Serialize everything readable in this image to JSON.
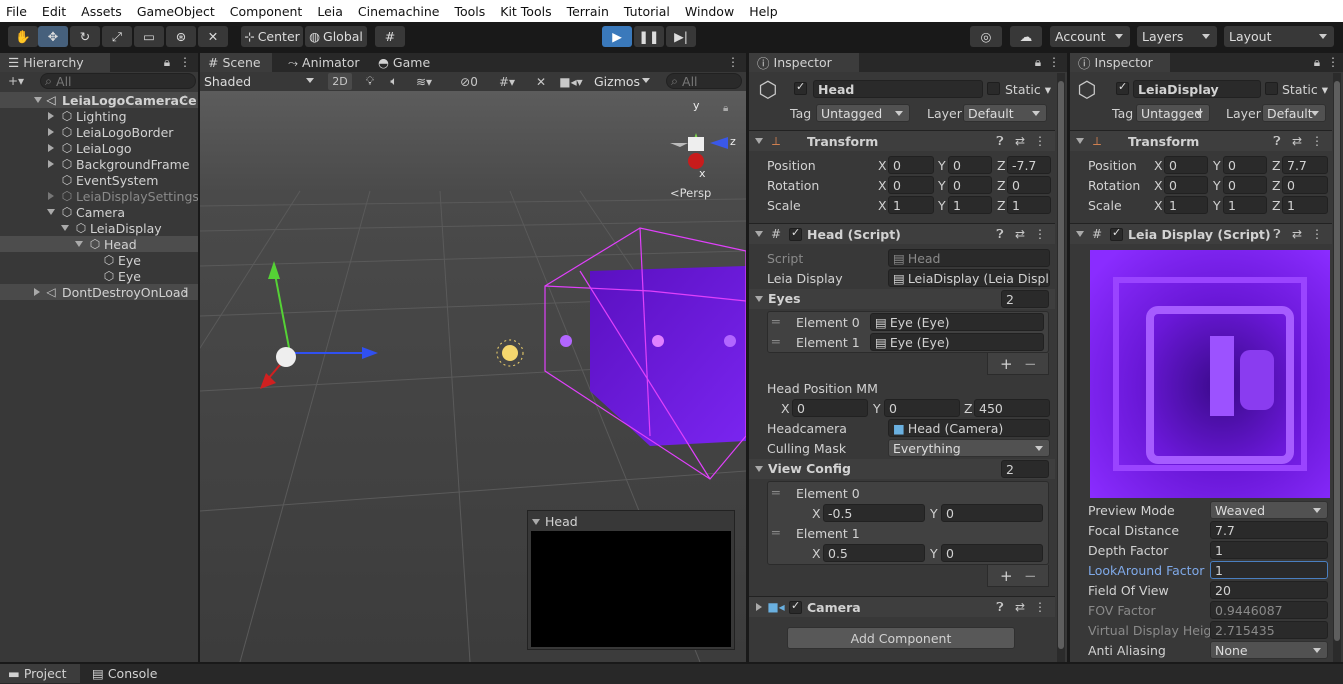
{
  "menu": {
    "items": [
      "File",
      "Edit",
      "Assets",
      "GameObject",
      "Component",
      "Leia",
      "Cinemachine",
      "Tools",
      "Kit Tools",
      "Terrain",
      "Tutorial",
      "Window",
      "Help"
    ]
  },
  "toolbar": {
    "center": "Center",
    "global": "Global",
    "account": "Account",
    "layers": "Layers",
    "layout": "Layout"
  },
  "hierarchy": {
    "tab": "Hierarchy",
    "search_placeholder": "All",
    "scene": "LeiaLogoCameraCe",
    "items": [
      "Lighting",
      "LeiaLogoBorder",
      "LeiaLogo",
      "BackgroundFrame",
      "EventSystem",
      "LeiaDisplaySettingsC",
      "Camera",
      "LeiaDisplay",
      "Head",
      "Eye",
      "Eye"
    ],
    "dontdestroy": "DontDestroyOnLoad"
  },
  "scene": {
    "tabs": [
      "Scene",
      "Animator",
      "Game"
    ],
    "shading": "Shaded",
    "mode_2d": "2D",
    "hidden_count": "0",
    "gizmos": "Gizmos",
    "search_placeholder": "All",
    "persp": "Persp",
    "gizmo_axes": {
      "y": "y",
      "z": "z",
      "x": "x"
    },
    "preview_title": "Head"
  },
  "inspector1": {
    "tab": "Inspector",
    "name": "Head",
    "static": "Static",
    "tag_label": "Tag",
    "tag": "Untagged",
    "layer_label": "Layer",
    "layer": "Default",
    "transform": {
      "title": "Transform",
      "position_label": "Position",
      "rotation_label": "Rotation",
      "scale_label": "Scale",
      "x": "X",
      "y": "Y",
      "z": "Z",
      "position": [
        "0",
        "0",
        "-7.7"
      ],
      "rotation": [
        "0",
        "0",
        "0"
      ],
      "scale": [
        "1",
        "1",
        "1"
      ]
    },
    "script": {
      "title": "Head (Script)",
      "script_label": "Script",
      "script_value": "Head",
      "leia_display_label": "Leia Display",
      "leia_display_value": "LeiaDisplay (Leia Displ",
      "eyes_label": "Eyes",
      "eyes_count": "2",
      "element0": "Element 0",
      "element1": "Element 1",
      "eye0": "Eye (Eye)",
      "eye1": "Eye (Eye)",
      "plus": "+",
      "minus": "−",
      "head_pos_label": "Head Position MM",
      "head_pos": [
        "0",
        "0",
        "450"
      ],
      "headcamera_label": "Headcamera",
      "headcamera_value": "Head (Camera)",
      "culling_label": "Culling Mask",
      "culling_value": "Everything",
      "view_config_label": "View Config",
      "view_config_count": "2",
      "vc0": {
        "x": "-0.5",
        "y": "0"
      },
      "vc1": {
        "x": "0.5",
        "y": "0"
      }
    },
    "camera_title": "Camera",
    "add_component": "Add Component"
  },
  "inspector2": {
    "tab": "Inspector",
    "name": "LeiaDisplay",
    "static": "Static",
    "tag_label": "Tag",
    "tag": "Untagged",
    "layer_label": "Layer",
    "layer": "Default",
    "transform": {
      "title": "Transform",
      "position_label": "Position",
      "rotation_label": "Rotation",
      "scale_label": "Scale",
      "x": "X",
      "y": "Y",
      "z": "Z",
      "position": [
        "0",
        "0",
        "7.7"
      ],
      "rotation": [
        "0",
        "0",
        "0"
      ],
      "scale": [
        "1",
        "1",
        "1"
      ]
    },
    "script": {
      "title": "Leia Display (Script)",
      "preview_mode_label": "Preview Mode",
      "preview_mode": "Weaved",
      "focal_label": "Focal Distance",
      "focal": "7.7",
      "depth_label": "Depth Factor",
      "depth": "1",
      "lookaround_label": "LookAround Factor",
      "lookaround": "1",
      "fov_label": "Field Of View",
      "fov": "20",
      "fov_factor_label": "FOV Factor",
      "fov_factor": "0.9446087",
      "vdh_label": "Virtual Display Height",
      "vdh": "2.715435",
      "aa_label": "Anti Aliasing",
      "aa": "None"
    }
  },
  "bottom": {
    "project": "Project",
    "console": "Console"
  },
  "colors": {
    "accent": "#46607c",
    "selection": "#2c5d87",
    "magenta": "#e040fb",
    "purple": "#7a1fe0"
  }
}
